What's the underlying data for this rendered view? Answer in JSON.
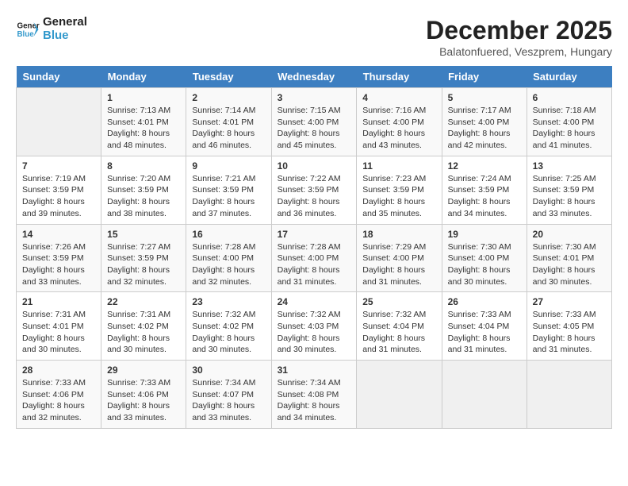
{
  "header": {
    "logo_line1": "General",
    "logo_line2": "Blue",
    "title": "December 2025",
    "subtitle": "Balatonfuered, Veszprem, Hungary"
  },
  "days_of_week": [
    "Sunday",
    "Monday",
    "Tuesday",
    "Wednesday",
    "Thursday",
    "Friday",
    "Saturday"
  ],
  "weeks": [
    [
      {
        "day": "",
        "info": ""
      },
      {
        "day": "1",
        "info": "Sunrise: 7:13 AM\nSunset: 4:01 PM\nDaylight: 8 hours\nand 48 minutes."
      },
      {
        "day": "2",
        "info": "Sunrise: 7:14 AM\nSunset: 4:01 PM\nDaylight: 8 hours\nand 46 minutes."
      },
      {
        "day": "3",
        "info": "Sunrise: 7:15 AM\nSunset: 4:00 PM\nDaylight: 8 hours\nand 45 minutes."
      },
      {
        "day": "4",
        "info": "Sunrise: 7:16 AM\nSunset: 4:00 PM\nDaylight: 8 hours\nand 43 minutes."
      },
      {
        "day": "5",
        "info": "Sunrise: 7:17 AM\nSunset: 4:00 PM\nDaylight: 8 hours\nand 42 minutes."
      },
      {
        "day": "6",
        "info": "Sunrise: 7:18 AM\nSunset: 4:00 PM\nDaylight: 8 hours\nand 41 minutes."
      }
    ],
    [
      {
        "day": "7",
        "info": "Sunrise: 7:19 AM\nSunset: 3:59 PM\nDaylight: 8 hours\nand 39 minutes."
      },
      {
        "day": "8",
        "info": "Sunrise: 7:20 AM\nSunset: 3:59 PM\nDaylight: 8 hours\nand 38 minutes."
      },
      {
        "day": "9",
        "info": "Sunrise: 7:21 AM\nSunset: 3:59 PM\nDaylight: 8 hours\nand 37 minutes."
      },
      {
        "day": "10",
        "info": "Sunrise: 7:22 AM\nSunset: 3:59 PM\nDaylight: 8 hours\nand 36 minutes."
      },
      {
        "day": "11",
        "info": "Sunrise: 7:23 AM\nSunset: 3:59 PM\nDaylight: 8 hours\nand 35 minutes."
      },
      {
        "day": "12",
        "info": "Sunrise: 7:24 AM\nSunset: 3:59 PM\nDaylight: 8 hours\nand 34 minutes."
      },
      {
        "day": "13",
        "info": "Sunrise: 7:25 AM\nSunset: 3:59 PM\nDaylight: 8 hours\nand 33 minutes."
      }
    ],
    [
      {
        "day": "14",
        "info": "Sunrise: 7:26 AM\nSunset: 3:59 PM\nDaylight: 8 hours\nand 33 minutes."
      },
      {
        "day": "15",
        "info": "Sunrise: 7:27 AM\nSunset: 3:59 PM\nDaylight: 8 hours\nand 32 minutes."
      },
      {
        "day": "16",
        "info": "Sunrise: 7:28 AM\nSunset: 4:00 PM\nDaylight: 8 hours\nand 32 minutes."
      },
      {
        "day": "17",
        "info": "Sunrise: 7:28 AM\nSunset: 4:00 PM\nDaylight: 8 hours\nand 31 minutes."
      },
      {
        "day": "18",
        "info": "Sunrise: 7:29 AM\nSunset: 4:00 PM\nDaylight: 8 hours\nand 31 minutes."
      },
      {
        "day": "19",
        "info": "Sunrise: 7:30 AM\nSunset: 4:00 PM\nDaylight: 8 hours\nand 30 minutes."
      },
      {
        "day": "20",
        "info": "Sunrise: 7:30 AM\nSunset: 4:01 PM\nDaylight: 8 hours\nand 30 minutes."
      }
    ],
    [
      {
        "day": "21",
        "info": "Sunrise: 7:31 AM\nSunset: 4:01 PM\nDaylight: 8 hours\nand 30 minutes."
      },
      {
        "day": "22",
        "info": "Sunrise: 7:31 AM\nSunset: 4:02 PM\nDaylight: 8 hours\nand 30 minutes."
      },
      {
        "day": "23",
        "info": "Sunrise: 7:32 AM\nSunset: 4:02 PM\nDaylight: 8 hours\nand 30 minutes."
      },
      {
        "day": "24",
        "info": "Sunrise: 7:32 AM\nSunset: 4:03 PM\nDaylight: 8 hours\nand 30 minutes."
      },
      {
        "day": "25",
        "info": "Sunrise: 7:32 AM\nSunset: 4:04 PM\nDaylight: 8 hours\nand 31 minutes."
      },
      {
        "day": "26",
        "info": "Sunrise: 7:33 AM\nSunset: 4:04 PM\nDaylight: 8 hours\nand 31 minutes."
      },
      {
        "day": "27",
        "info": "Sunrise: 7:33 AM\nSunset: 4:05 PM\nDaylight: 8 hours\nand 31 minutes."
      }
    ],
    [
      {
        "day": "28",
        "info": "Sunrise: 7:33 AM\nSunset: 4:06 PM\nDaylight: 8 hours\nand 32 minutes."
      },
      {
        "day": "29",
        "info": "Sunrise: 7:33 AM\nSunset: 4:06 PM\nDaylight: 8 hours\nand 33 minutes."
      },
      {
        "day": "30",
        "info": "Sunrise: 7:34 AM\nSunset: 4:07 PM\nDaylight: 8 hours\nand 33 minutes."
      },
      {
        "day": "31",
        "info": "Sunrise: 7:34 AM\nSunset: 4:08 PM\nDaylight: 8 hours\nand 34 minutes."
      },
      {
        "day": "",
        "info": ""
      },
      {
        "day": "",
        "info": ""
      },
      {
        "day": "",
        "info": ""
      }
    ]
  ]
}
